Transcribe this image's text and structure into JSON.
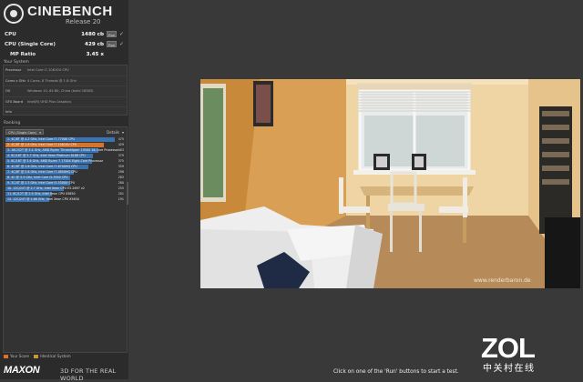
{
  "app": {
    "title": "CINEBENCH",
    "release": "Release 20"
  },
  "scores": [
    {
      "label": "CPU",
      "value": "1480 cb",
      "run": "Run"
    },
    {
      "label": "CPU (Single Core)",
      "value": "429 cb",
      "run": "Run"
    }
  ],
  "mp_ratio": {
    "label": "MP Ratio",
    "value": "3.45 x"
  },
  "system": {
    "title": "Your System",
    "rows": [
      {
        "key": "Processor",
        "value": "Intel Core i7-10610U CPU"
      },
      {
        "key": "Cores x GHz",
        "value": "4 Cores, 8 Threads @ 1.8 GHz"
      },
      {
        "key": "OS",
        "value": "Windows 10, 64 Bit, China (build 18363)"
      },
      {
        "key": "GFX Board",
        "value": "Intel(R) UHD Plus Graphics"
      },
      {
        "key": "Info",
        "value": ""
      }
    ]
  },
  "ranking": {
    "title": "Ranking",
    "mode": "CPU (Single Core)",
    "details": "Details",
    "max": 475,
    "items": [
      {
        "label": "1. 4C/8T @ 4.2 GHz, Intel Core i7-7700K CPU",
        "score": 475,
        "kind": "ref"
      },
      {
        "label": "2. 4C/8T @ 1.8 GHz, Intel Core i7-10610U CPU",
        "score": 429,
        "kind": "yours"
      },
      {
        "label": "3. 16C/32T @ 3.4 GHz, AMD Ryzen Threadripper 1950X 16-Core Processor",
        "score": 403,
        "kind": "ref"
      },
      {
        "label": "4. 8C/16T @ 3.7 GHz, Intel Xeon Platinum 8168 CPU",
        "score": 379,
        "kind": "ref"
      },
      {
        "label": "5. 8C/16T @ 3.6 GHz, AMD Ryzen 7 1700X Eight-Core Processor",
        "score": 375,
        "kind": "ref"
      },
      {
        "label": "6. 4C/8T @ 2.6 GHz, Intel Core i7-6700HQ CPU",
        "score": 359,
        "kind": "ref"
      },
      {
        "label": "7. 4C/8T @ 2.8 GHz, Intel Core i7-4850HQ CPU",
        "score": 298,
        "kind": "ref"
      },
      {
        "label": "8. 4C @ 3.3 GHz, Intel Core i5-3550 CPU",
        "score": 283,
        "kind": "ref"
      },
      {
        "label": "9. 2C/4T @ 2.3 GHz, Intel Core i5-5300U CPU",
        "score": 280,
        "kind": "ref"
      },
      {
        "label": "10. 12C/24T @ 2.7 GHz, Intel Xeon CPU E5-2697 v2",
        "score": 255,
        "kind": "ref"
      },
      {
        "label": "11. 6C/12T @ 2.9 GHz, Intel Xeon CPU X5650",
        "score": 201,
        "kind": "ref"
      },
      {
        "label": "12. 12C/24T @ 2.66 GHz, Intel Xeon CPU X5650",
        "score": 191,
        "kind": "ref"
      }
    ]
  },
  "legend": {
    "your_score": "Your Score",
    "identical": "Identical System"
  },
  "brand": {
    "maxon": "MAXON",
    "tagline": "3D FOR THE REAL WORLD"
  },
  "render": {
    "watermark": "www.renderbaron.de"
  },
  "status": "Click on one of the 'Run' buttons to start a test.",
  "watermark": {
    "zol": "ZOL",
    "zol_sub": "中关村在线"
  },
  "colors": {
    "rank_bar": "#3b73b0",
    "your_bar": "#d8732a",
    "identical": "#c9982f"
  }
}
